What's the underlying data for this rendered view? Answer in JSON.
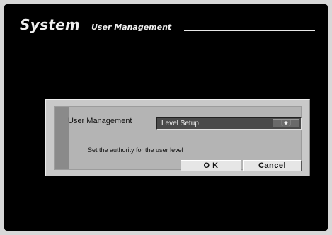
{
  "header": {
    "title": "System",
    "subtitle": "User Management"
  },
  "dialog": {
    "label": "User Management",
    "select": {
      "value": "Level Setup",
      "button_glyph": "[◆]"
    },
    "message": "Set the authority for the user level",
    "ok_label": "O K",
    "cancel_label": "Cancel"
  }
}
